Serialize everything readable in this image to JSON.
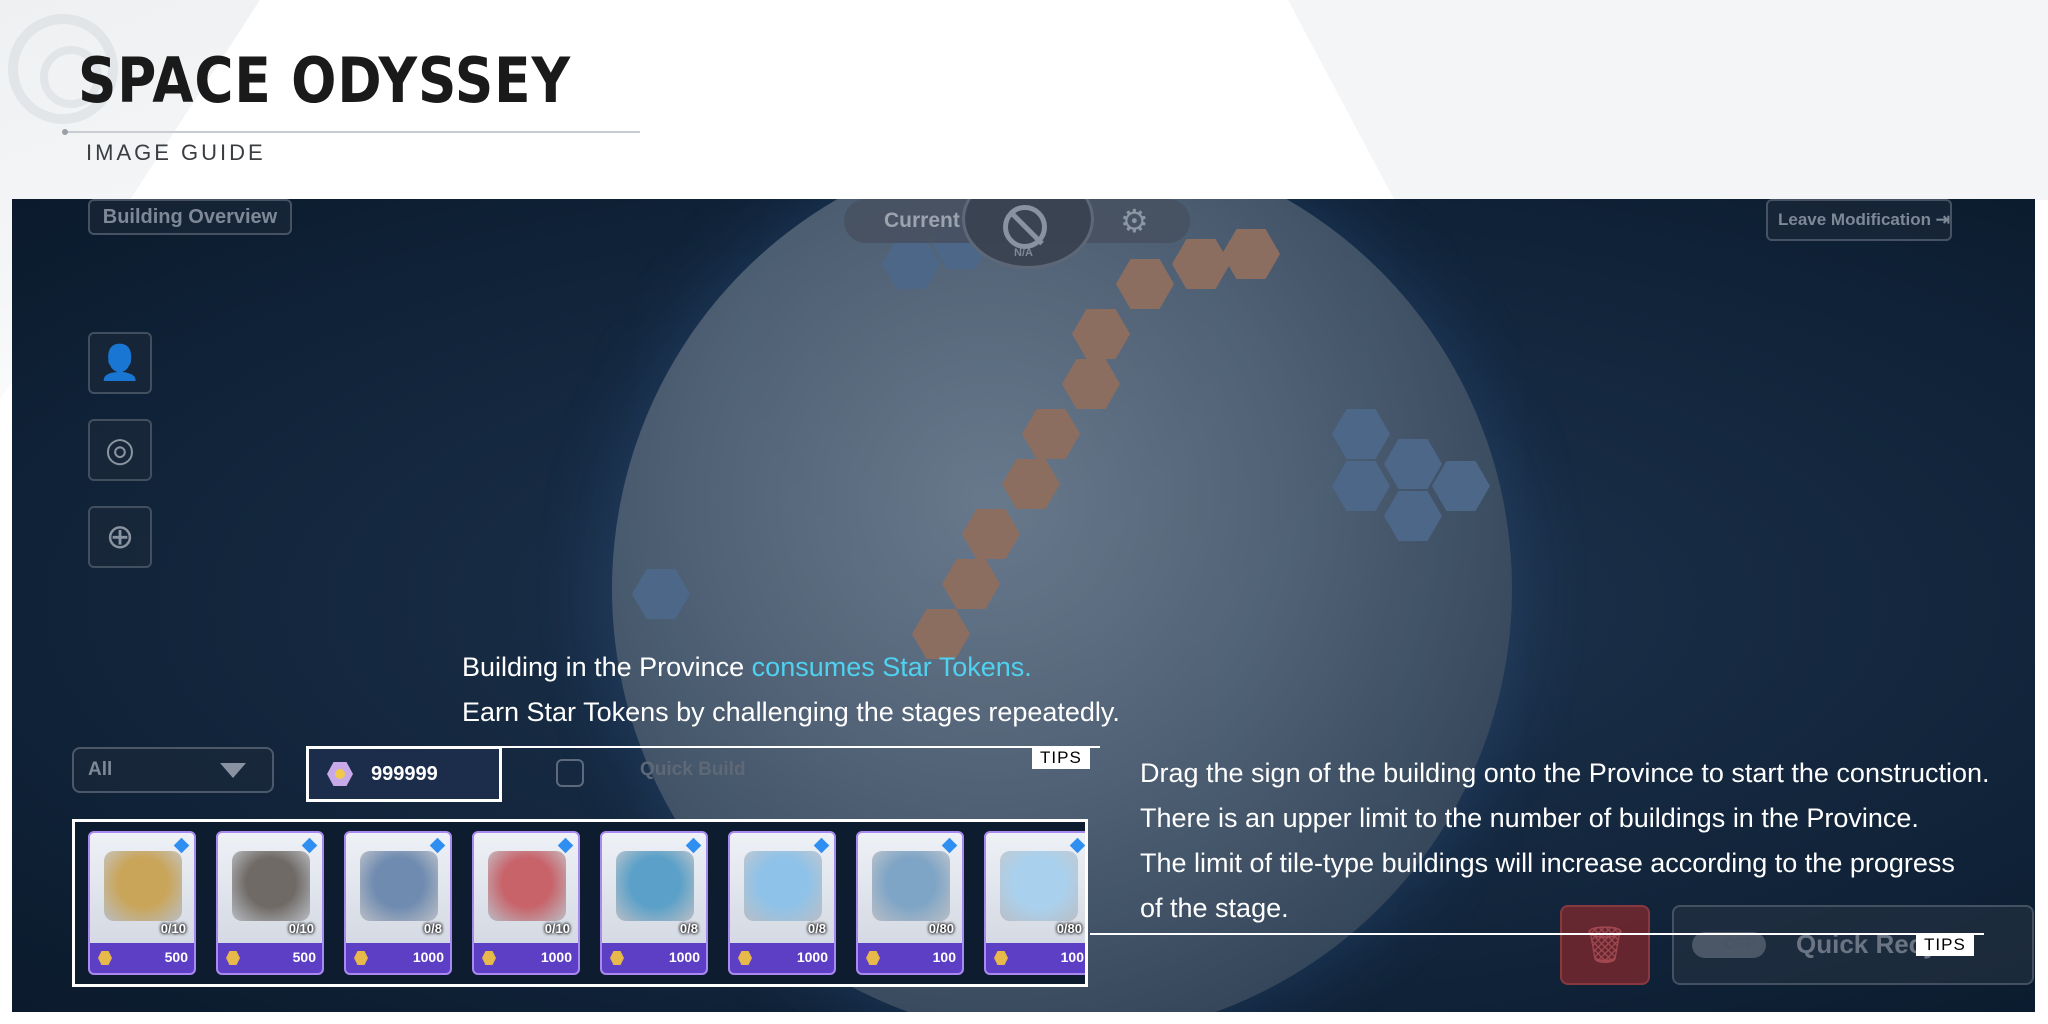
{
  "header": {
    "title": "SPACE ODYSSEY",
    "subtitle": "IMAGE GUIDE"
  },
  "game": {
    "overview_button": "Building Overview",
    "current_label": "Current",
    "current_value": "N/A",
    "leave_button": "Leave Modification",
    "side_icons": [
      "profile-icon",
      "target-icon",
      "crosshair-icon"
    ],
    "filter": {
      "selected": "All"
    },
    "star_tokens": "999999",
    "quick_build_label": "Quick Build",
    "buildings": [
      {
        "count": "0/10",
        "price": "500",
        "color": "#c9a55a"
      },
      {
        "count": "0/10",
        "price": "500",
        "color": "#6f6a66"
      },
      {
        "count": "0/8",
        "price": "1000",
        "color": "#6f8bb0"
      },
      {
        "count": "0/10",
        "price": "1000",
        "color": "#c8636a"
      },
      {
        "count": "0/8",
        "price": "1000",
        "color": "#5aa0c8"
      },
      {
        "count": "0/8",
        "price": "1000",
        "color": "#8fc2e8"
      },
      {
        "count": "0/80",
        "price": "100",
        "color": "#7fa5c6"
      },
      {
        "count": "0/80",
        "price": "100",
        "color": "#a9d1ee"
      }
    ],
    "recycle": {
      "toggle": "OFF",
      "label": "Quick Recycle"
    }
  },
  "tips": {
    "top": {
      "line1_prefix": "Building in the Province ",
      "line1_highlight": "consumes Star Tokens.",
      "line2": "Earn Star Tokens by challenging the stages repeatedly.",
      "tag": "TIPS"
    },
    "right": {
      "lines": [
        "Drag the sign of the building onto the Province to start the construction.",
        "There is an upper limit to the number of buildings in the Province.",
        "The limit of tile-type buildings will increase according to the progress",
        "of the stage."
      ],
      "tag": "TIPS"
    }
  }
}
